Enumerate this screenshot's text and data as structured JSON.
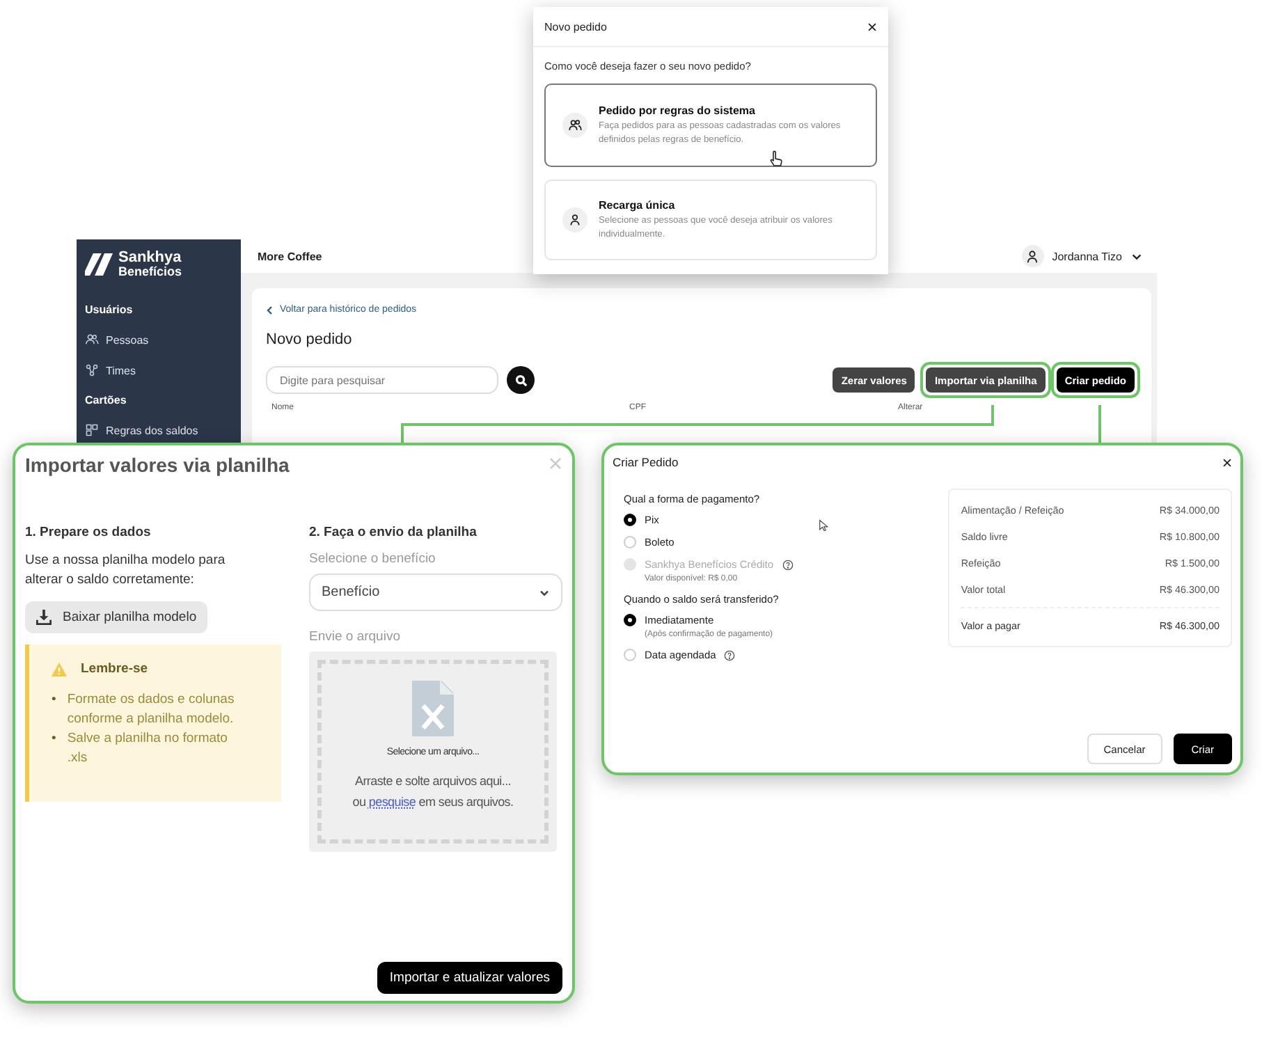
{
  "app": {
    "brand": [
      "Sankhya",
      "Benefícios"
    ],
    "sidebar": [
      {
        "kind": "section",
        "label": "Usuários"
      },
      {
        "kind": "item",
        "label": "Pessoas"
      },
      {
        "kind": "item",
        "label": "Times"
      },
      {
        "kind": "section",
        "label": "Cartões"
      },
      {
        "kind": "item",
        "label": "Regras dos saldos"
      }
    ],
    "company": "More Coffee",
    "user": "Jordanna Tizo",
    "back_link": "Voltar para histórico de pedidos",
    "title": "Novo pedido",
    "search": {
      "placeholder": "Digite para pesquisar"
    },
    "buttons": [
      {
        "label": "Zerar valores",
        "highlighted": false,
        "primary": false
      },
      {
        "label": "Importar via planilha",
        "highlighted": true,
        "primary": false
      },
      {
        "label": "Criar pedido",
        "highlighted": true,
        "primary": true
      }
    ],
    "table_columns": [
      "Nome",
      "CPF",
      "Alterar"
    ]
  },
  "new_order_dialog": {
    "title": "Novo pedido",
    "question": "Como você deseja fazer o seu novo pedido?",
    "options": [
      {
        "title": "Pedido por regras do sistema",
        "description": "Faça pedidos para as pessoas cadastradas com os valores definidos pelas regras de benefício.",
        "selected": true
      },
      {
        "title": "Recarga única",
        "description": "Selecione as pessoas que você deseja atribuir os valores individualmente.",
        "selected": false
      }
    ]
  },
  "import_dialog": {
    "title": "Importar valores via planilha",
    "step1": {
      "heading": "1. Prepare os dados",
      "text": "Use a nossa planilha modelo para alterar o saldo corretamente:",
      "download_button": "Baixar planilha modelo",
      "note": {
        "title": "Lembre-se",
        "bullet": "•",
        "items": [
          "Formate os dados e colunas conforme a planilha modelo.",
          "Salve a planilha no formato .xls"
        ]
      }
    },
    "step2": {
      "heading": "2. Faça o envio da planilha",
      "select_label": "Selecione o benefício",
      "select_value": "Benefício",
      "file_label": "Envie o arquivo",
      "drop_title": "Selecione um arquivo...",
      "drop_text": "Arraste e solte arquivos aqui...",
      "drop_or": "ou",
      "drop_link": "pesquise",
      "drop_rest": "em seus arquivos."
    },
    "submit": "Importar e atualizar valores"
  },
  "create_dialog": {
    "title": "Criar Pedido",
    "groups": [
      {
        "question": "Qual a forma de pagamento?",
        "options": [
          {
            "label": "Pix",
            "selected": true,
            "disabled": false,
            "help": false
          },
          {
            "label": "Boleto",
            "selected": false,
            "disabled": false,
            "help": false
          },
          {
            "label": "Sankhya Benefícios Crédito",
            "selected": false,
            "disabled": true,
            "help": true,
            "note": "Valor disponível: R$ 0,00"
          }
        ]
      },
      {
        "question": "Quando o saldo será transferido?",
        "options": [
          {
            "label": "Imediatamente",
            "selected": true,
            "disabled": false,
            "help": false,
            "note": "(Após confirmação de pagamento)"
          },
          {
            "label": "Data agendada",
            "selected": false,
            "disabled": false,
            "help": true
          }
        ]
      }
    ],
    "summary": [
      {
        "kind": "line",
        "label": "Alimentação / Refeição",
        "value": "R$ 34.000,00"
      },
      {
        "kind": "line",
        "label": "Saldo livre",
        "value": "R$ 10.800,00"
      },
      {
        "kind": "line",
        "label": "Refeição",
        "value": "R$ 1.500,00"
      },
      {
        "kind": "line",
        "label": "Valor total",
        "value": "R$ 46.300,00"
      },
      {
        "kind": "due",
        "label": "Valor a pagar",
        "value": "R$ 46.300,00"
      }
    ],
    "buttons": [
      {
        "label": "Cancelar",
        "primary": false
      },
      {
        "label": "Criar",
        "primary": true
      }
    ]
  }
}
